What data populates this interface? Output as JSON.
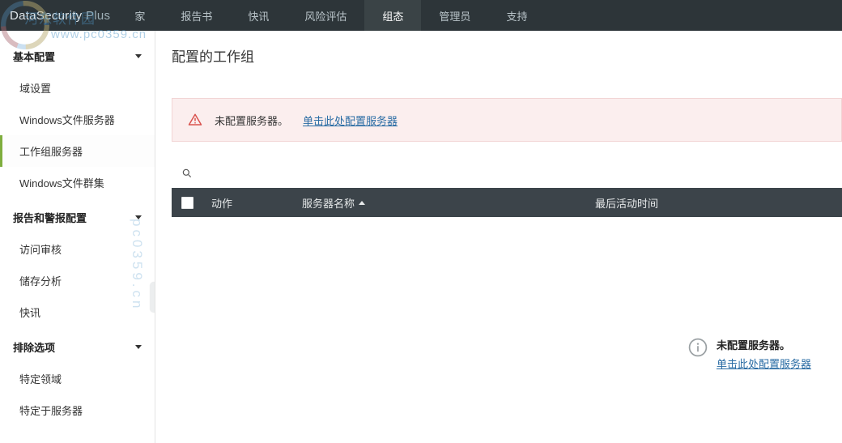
{
  "brand": {
    "name": "DataSecurity",
    "suffix": "Plus"
  },
  "nav": {
    "home": "家",
    "report": "报告书",
    "news": "快讯",
    "risk": "风险评估",
    "config": "组态",
    "admin": "管理员",
    "support": "支持"
  },
  "sidebar": {
    "basic": {
      "title": "基本配置",
      "domain": "域设置",
      "winfs": "Windows文件服务器",
      "workgroup": "工作组服务器",
      "wincluster": "Windows文件群集"
    },
    "report": {
      "title": "报告和警报配置",
      "audit": "访问审核",
      "storage": "储存分析",
      "news": "快讯"
    },
    "exclude": {
      "title": "排除选项",
      "domain": "特定领域",
      "server": "特定于服务器"
    }
  },
  "page": {
    "title": "配置的工作组"
  },
  "alert": {
    "message": "未配置服务器。",
    "link": "单击此处配置服务器"
  },
  "table": {
    "action": "动作",
    "server_name": "服务器名称",
    "last_activity": "最后活动时间"
  },
  "empty": {
    "title": "未配置服务器。",
    "link": "单击此处配置服务器"
  },
  "watermark": {
    "site": "河东软件园",
    "url": "www.pc0359.cn",
    "side": "pc0359.cn"
  }
}
